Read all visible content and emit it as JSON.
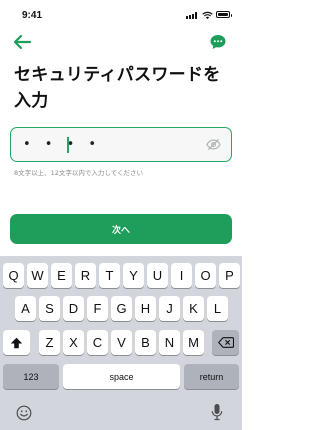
{
  "status_bar": {
    "time": "9:41"
  },
  "title": "セキュリティパスワードを入力",
  "password_field": {
    "value": "• • • •"
  },
  "hint": "8文字以上、12文字以内で入力してください",
  "next_button": "次へ",
  "keyboard": {
    "row1": [
      "Q",
      "W",
      "E",
      "R",
      "T",
      "Y",
      "U",
      "I",
      "O",
      "P"
    ],
    "row2": [
      "A",
      "S",
      "D",
      "F",
      "G",
      "H",
      "J",
      "K",
      "L"
    ],
    "row3": [
      "Z",
      "X",
      "C",
      "V",
      "B",
      "N",
      "M"
    ],
    "numbers_key": "123",
    "space_key": "space",
    "return_key": "return"
  },
  "colors": {
    "accent": "#1f9d5a",
    "border": "#25a865",
    "keyboard_bg": "#d2d5db"
  },
  "icons": [
    "back-arrow-icon",
    "chat-icon",
    "eye-slash-icon",
    "shift-icon",
    "delete-icon",
    "emoji-icon",
    "microphone-icon"
  ]
}
